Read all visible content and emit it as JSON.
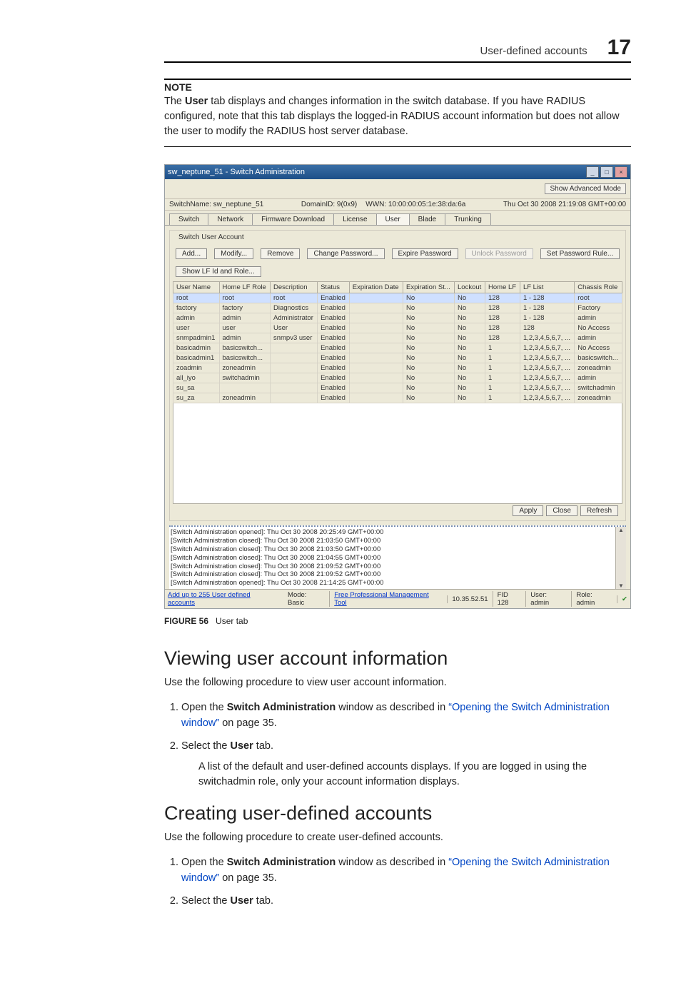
{
  "header": {
    "section": "User-defined accounts",
    "chapter": "17"
  },
  "note": {
    "label": "NOTE",
    "body_pre": "The ",
    "body_bold1": "User",
    "body_post": " tab displays and changes information in the switch database. If you have RADIUS configured, note that this tab displays the logged-in RADIUS account information but does not allow the user to modify the RADIUS host server database."
  },
  "screenshot": {
    "window_title": "sw_neptune_51 - Switch Administration",
    "topbar": {
      "switch_label": "SwitchName: sw_neptune_51",
      "domain": "DomainID: 9(0x9)",
      "wwn": "WWN: 10:00:00:05:1e:38:da:6a",
      "timestamp": "Thu Oct 30 2008 21:19:08 GMT+00:00",
      "advmode": "Show Advanced Mode"
    },
    "tabs": [
      "Switch",
      "Network",
      "Firmware Download",
      "License",
      "User",
      "Blade",
      "Trunking"
    ],
    "active_tab": "User",
    "panel_title": "Switch User Account",
    "toolbar": {
      "add": "Add...",
      "modify": "Modify...",
      "remove": "Remove",
      "changepw": "Change Password...",
      "expirepw": "Expire Password",
      "unlockpw": "Unlock Password",
      "setrule": "Set Password Rule...",
      "showlf": "Show LF Id and Role..."
    },
    "columns": [
      "User Name",
      "Home LF Role",
      "Description",
      "Status",
      "Expiration Date",
      "Expiration St...",
      "Lockout",
      "Home LF",
      "LF List",
      "Chassis Role"
    ],
    "rows": [
      {
        "sel": true,
        "c": [
          "root",
          "root",
          "root",
          "Enabled",
          "",
          "No",
          "No",
          "128",
          "1 - 128",
          "root"
        ]
      },
      {
        "sel": false,
        "c": [
          "factory",
          "factory",
          "Diagnostics",
          "Enabled",
          "",
          "No",
          "No",
          "128",
          "1 - 128",
          "Factory"
        ]
      },
      {
        "sel": false,
        "c": [
          "admin",
          "admin",
          "Administrator",
          "Enabled",
          "",
          "No",
          "No",
          "128",
          "1 - 128",
          "admin"
        ]
      },
      {
        "sel": false,
        "c": [
          "user",
          "user",
          "User",
          "Enabled",
          "",
          "No",
          "No",
          "128",
          "128",
          "No Access"
        ]
      },
      {
        "sel": false,
        "c": [
          "snmpadmin1",
          "admin",
          "snmpv3 user",
          "Enabled",
          "",
          "No",
          "No",
          "128",
          "1,2,3,4,5,6,7, ...",
          "admin"
        ]
      },
      {
        "sel": false,
        "c": [
          "basicadmin",
          "basicswitch...",
          "",
          "Enabled",
          "",
          "No",
          "No",
          "1",
          "1,2,3,4,5,6,7, ...",
          "No Access"
        ]
      },
      {
        "sel": false,
        "c": [
          "basicadmin1",
          "basicswitch...",
          "",
          "Enabled",
          "",
          "No",
          "No",
          "1",
          "1,2,3,4,5,6,7, ...",
          "basicswitch..."
        ]
      },
      {
        "sel": false,
        "c": [
          "zoadmin",
          "zoneadmin",
          "",
          "Enabled",
          "",
          "No",
          "No",
          "1",
          "1,2,3,4,5,6,7, ...",
          "zoneadmin"
        ]
      },
      {
        "sel": false,
        "c": [
          "all_iyo",
          "switchadmin",
          "",
          "Enabled",
          "",
          "No",
          "No",
          "1",
          "1,2,3,4,5,6,7, ...",
          "admin"
        ]
      },
      {
        "sel": false,
        "c": [
          "su_sa",
          "",
          "",
          "Enabled",
          "",
          "No",
          "No",
          "1",
          "1,2,3,4,5,6,7, ...",
          "switchadmin"
        ]
      },
      {
        "sel": false,
        "c": [
          "su_za",
          "zoneadmin",
          "",
          "Enabled",
          "",
          "No",
          "No",
          "1",
          "1,2,3,4,5,6,7, ...",
          "zoneadmin"
        ]
      }
    ],
    "actions": {
      "apply": "Apply",
      "close": "Close",
      "refresh": "Refresh"
    },
    "log": [
      "[Switch Administration opened]: Thu Oct 30 2008 20:25:49 GMT+00:00",
      "[Switch Administration closed]: Thu Oct 30 2008 21:03:50 GMT+00:00",
      "[Switch Administration closed]: Thu Oct 30 2008 21:03:50 GMT+00:00",
      "[Switch Administration closed]: Thu Oct 30 2008 21:04:55 GMT+00:00",
      "[Switch Administration closed]: Thu Oct 30 2008 21:09:52 GMT+00:00",
      "[Switch Administration closed]: Thu Oct 30 2008 21:09:52 GMT+00:00",
      "[Switch Administration opened]: Thu Oct 30 2008 21:14:25 GMT+00:00"
    ],
    "status": {
      "hint": "Add up to 255 User defined accounts",
      "mode": "Mode: Basic",
      "tool": "Free Professional Management Tool",
      "ip": "10.35.52.51",
      "fid": "FID 128",
      "user": "User: admin",
      "role": "Role: admin"
    }
  },
  "figure": {
    "label": "FIGURE 56",
    "title": "User tab"
  },
  "h_view": "Viewing user account information",
  "view_intro": "Use the following procedure to view user account information.",
  "step_open_pre": "Open the ",
  "step_open_bold": "Switch Administration",
  "step_open_mid": " window as described in ",
  "step_open_xref": "“Opening the Switch Administration window”",
  "step_open_post": " on page 35.",
  "step_select_pre": "Select the ",
  "step_select_bold": "User",
  "step_select_post": " tab.",
  "view_sub": "A list of the default and user-defined accounts displays. If you are logged in using the switchadmin role, only your account information displays.",
  "h_create": "Creating user-defined accounts",
  "create_intro": "Use the following procedure to create user-defined accounts."
}
